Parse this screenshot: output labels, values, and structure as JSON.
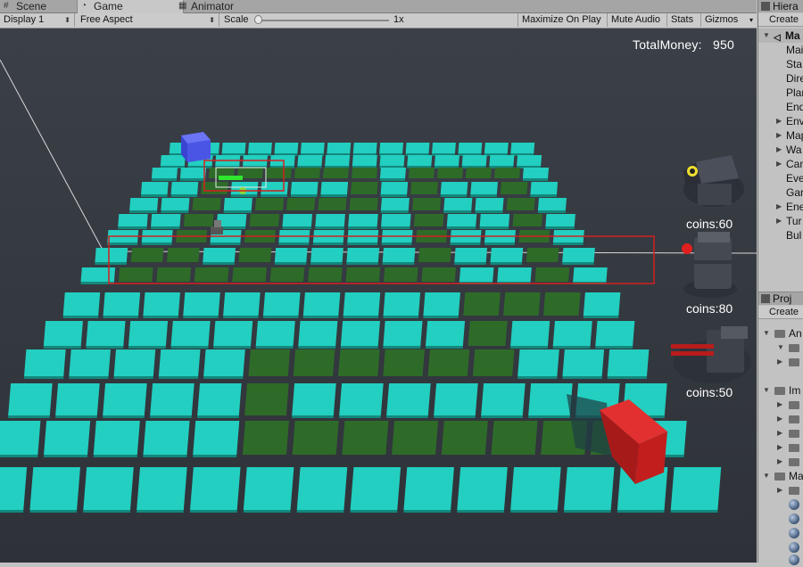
{
  "tabs": [
    {
      "label": "Scene",
      "icon": "hash-icon"
    },
    {
      "label": "Game",
      "icon": "pacman-icon"
    },
    {
      "label": "Animator",
      "icon": "grid-icon"
    }
  ],
  "toolbar": {
    "display": "Display 1",
    "aspect": "Free Aspect",
    "scale_label": "Scale",
    "scale_value": "1x",
    "maximize": "Maximize On Play",
    "mute": "Mute Audio",
    "stats": "Stats",
    "gizmos": "Gizmos"
  },
  "game": {
    "total_money_label": "TotalMoney:",
    "total_money_value": "950",
    "turret_costs": [
      "coins:60",
      "coins:80",
      "coins:50"
    ],
    "colors": {
      "tile": "#22cfc0",
      "path": "#2e6b29",
      "start_cube": "#4a55e6",
      "end_cube": "#c21e1e",
      "selection": "#d42020",
      "health": "#2ee62e"
    }
  },
  "hierarchy": {
    "tab": "Hiera",
    "create": "Create",
    "scene": "Ma",
    "items": [
      {
        "label": "Mai",
        "expandable": false
      },
      {
        "label": "Sta",
        "expandable": false
      },
      {
        "label": "Dire",
        "expandable": false
      },
      {
        "label": "Plan",
        "expandable": false
      },
      {
        "label": "End",
        "expandable": false
      },
      {
        "label": "Env",
        "expandable": true
      },
      {
        "label": "Map",
        "expandable": true
      },
      {
        "label": "Wa",
        "expandable": true
      },
      {
        "label": "Can",
        "expandable": true
      },
      {
        "label": "Eve",
        "expandable": false
      },
      {
        "label": "Gar",
        "expandable": false
      },
      {
        "label": "Ene",
        "expandable": true
      },
      {
        "label": "Tur",
        "expandable": true
      },
      {
        "label": "Bul",
        "expandable": false
      }
    ]
  },
  "project": {
    "tab": "Proj",
    "create": "Create",
    "folders": [
      "An",
      "Im",
      "Ma"
    ]
  }
}
